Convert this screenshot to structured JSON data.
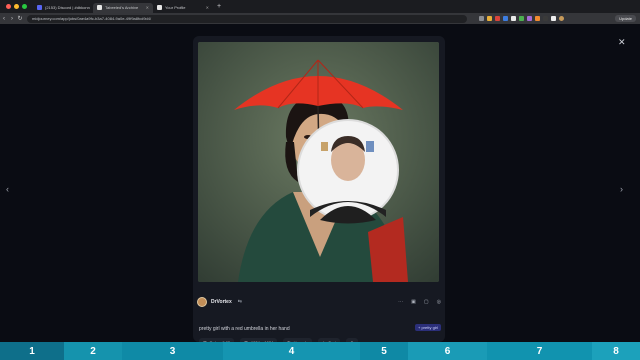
{
  "browser": {
    "tabs": [
      {
        "label": "(2153) Discord | #dbkonn",
        "color": "#5865f2",
        "active": false
      },
      {
        "label": "Tabeeled's Archive",
        "color": "#ffffff",
        "active": true
      },
      {
        "label": "Your Profile",
        "color": "#ffffff",
        "active": false
      }
    ],
    "url": "midjourney.com/app/jobs/0ae4a9fc-b3a7-4084-9a0e-49f9a8fcd9d4/",
    "update_label": "Update"
  },
  "post": {
    "author": "DrVortex",
    "prompt": "pretty girl with a red umbrella in her hand",
    "tag": "+ pretty girl",
    "time": "Today, 9:05",
    "size": "1024 × 1024",
    "upscale": "Upscale",
    "speed": "Fast"
  },
  "timeline": [
    {
      "label": "1",
      "color": "#0e6f8a",
      "width": 64
    },
    {
      "label": "2",
      "color": "#1593ad",
      "width": 58
    },
    {
      "label": "3",
      "color": "#0f8aa6",
      "width": 101
    },
    {
      "label": "4",
      "color": "#1595b1",
      "width": 137
    },
    {
      "label": "5",
      "color": "#0f89a5",
      "width": 48
    },
    {
      "label": "6",
      "color": "#1a9bb6",
      "width": 79
    },
    {
      "label": "7",
      "color": "#1193af",
      "width": 105
    },
    {
      "label": "8",
      "color": "#1ca1bb",
      "width": 48
    }
  ]
}
